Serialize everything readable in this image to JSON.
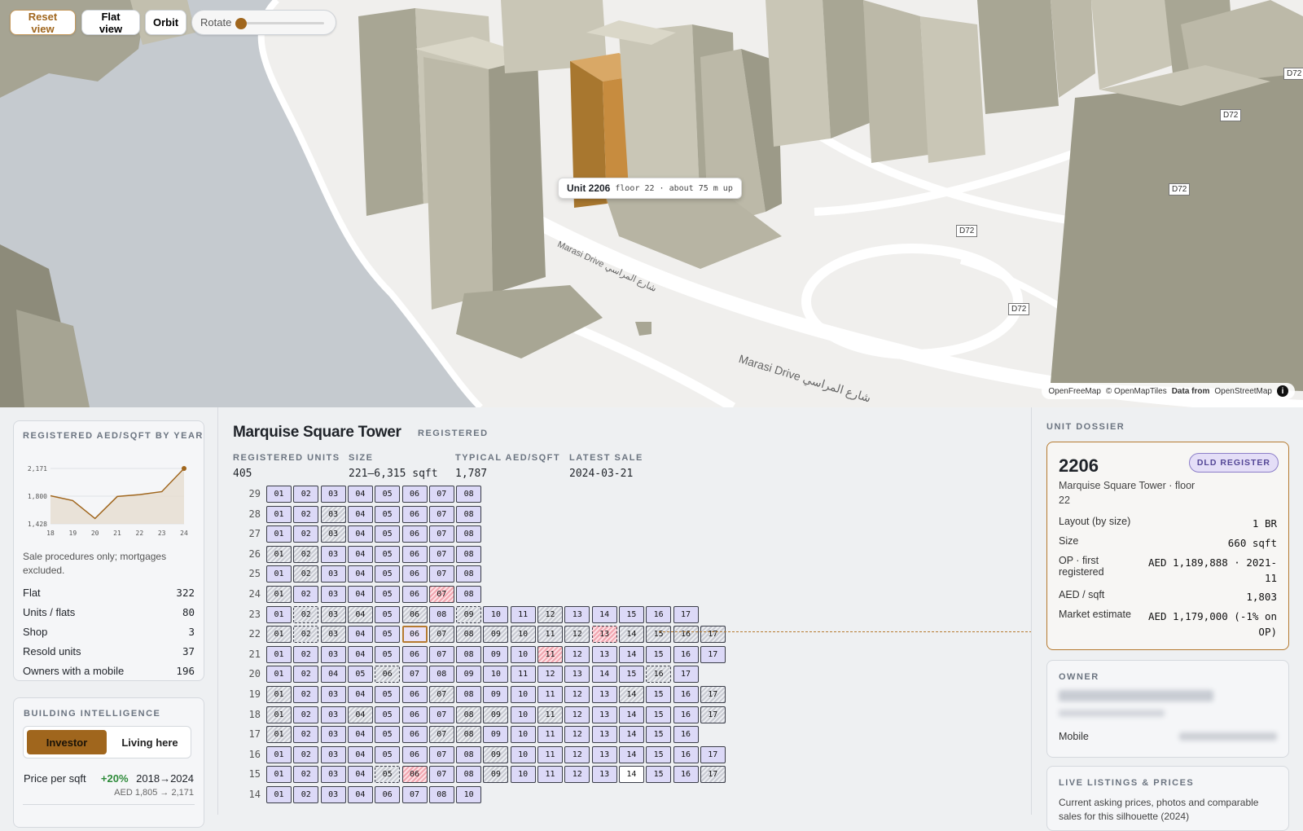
{
  "map": {
    "controls": {
      "reset": "Reset view",
      "flat": "Flat view",
      "orbit": "Orbit",
      "rotate": "Rotate"
    },
    "tooltip": {
      "unit": "Unit 2206",
      "detail": "floor 22 · about 75 m up"
    },
    "road_labels": [
      "D72",
      "D72",
      "D72",
      "D72",
      "D72"
    ],
    "street_labels": [
      "Marasi Drive شارع المراسي",
      "Marasi Drive شارع المراسي"
    ],
    "attribution": {
      "a": "OpenFreeMap",
      "b": "© OpenMapTiles",
      "c": "Data from",
      "d": "OpenStreetMap",
      "info": "i"
    },
    "colors": {
      "water": "#c5cacf",
      "land": "#f0efed",
      "building_light": "#c9c6b6",
      "building_dark": "#9c9a88",
      "highlight": "#b57a30"
    }
  },
  "left": {
    "chart_card": {
      "kicker": "REGISTERED AED/SQFT BY YEAR",
      "note": "Sale procedures only; mortgages excluded.",
      "rows": [
        {
          "label": "Flat",
          "value": "322"
        },
        {
          "label": "Units / flats",
          "value": "80"
        },
        {
          "label": "Shop",
          "value": "3"
        },
        {
          "label": "Resold units",
          "value": "37"
        },
        {
          "label": "Owners with a mobile",
          "value": "196"
        }
      ]
    },
    "intel_card": {
      "kicker": "BUILDING INTELLIGENCE",
      "tabs": [
        "Investor",
        "Living here"
      ],
      "price_label": "Price per sqft",
      "price_change": "+20%",
      "price_years": "2018→2024",
      "price_range": "AED 1,805 → 2,171"
    }
  },
  "chart_data": {
    "type": "line",
    "title": "REGISTERED AED/SQFT BY YEAR",
    "x": [
      "18",
      "19",
      "20",
      "21",
      "22",
      "23",
      "24"
    ],
    "values": [
      1805,
      1740,
      1500,
      1795,
      1820,
      1860,
      2171
    ],
    "yticks": [
      "2,171",
      "1,800",
      "1,428"
    ],
    "ylim": [
      1428,
      2171
    ],
    "color": "#a0661d"
  },
  "center": {
    "title": "Marquise Square Tower",
    "status": "REGISTERED",
    "stats": [
      {
        "label": "REGISTERED UNITS",
        "value": "405"
      },
      {
        "label": "SIZE",
        "value": "221–6,315 sqft"
      },
      {
        "label": "TYPICAL AED/SQFT",
        "value": "1,787"
      },
      {
        "label": "LATEST SALE",
        "value": "2024-03-21"
      }
    ],
    "floors": [
      {
        "floor": "29",
        "units": [
          "01",
          "02",
          "03",
          "04",
          "05",
          "06",
          "07",
          "08"
        ],
        "hatched": [],
        "pink": [],
        "dashed": []
      },
      {
        "floor": "28",
        "units": [
          "01",
          "02",
          "03",
          "04",
          "05",
          "06",
          "07",
          "08"
        ],
        "hatched": [
          "03"
        ],
        "pink": [],
        "dashed": []
      },
      {
        "floor": "27",
        "units": [
          "01",
          "02",
          "03",
          "04",
          "05",
          "06",
          "07",
          "08"
        ],
        "hatched": [
          "03"
        ],
        "pink": [],
        "dashed": []
      },
      {
        "floor": "26",
        "units": [
          "01",
          "02",
          "03",
          "04",
          "05",
          "06",
          "07",
          "08"
        ],
        "hatched": [
          "01",
          "02"
        ],
        "pink": [],
        "dashed": []
      },
      {
        "floor": "25",
        "units": [
          "01",
          "02",
          "03",
          "04",
          "05",
          "06",
          "07",
          "08"
        ],
        "hatched": [
          "02"
        ],
        "pink": [],
        "dashed": []
      },
      {
        "floor": "24",
        "units": [
          "01",
          "02",
          "03",
          "04",
          "05",
          "06",
          "07",
          "08"
        ],
        "hatched": [
          "01"
        ],
        "pink": [
          "07"
        ],
        "dashed": []
      },
      {
        "floor": "23",
        "units": [
          "01",
          "02",
          "03",
          "04",
          "05",
          "06",
          "08",
          "09",
          "10",
          "11",
          "12",
          "13",
          "14",
          "15",
          "16",
          "17"
        ],
        "hatched": [
          "02",
          "03",
          "04",
          "06",
          "09",
          "12"
        ],
        "pink": [],
        "dashed": [
          "02",
          "09"
        ]
      },
      {
        "floor": "22",
        "units": [
          "01",
          "02",
          "03",
          "04",
          "05",
          "06",
          "07",
          "08",
          "09",
          "10",
          "11",
          "12",
          "13",
          "14",
          "15",
          "16",
          "17"
        ],
        "hatched": [
          "01",
          "02",
          "03",
          "07",
          "08",
          "09",
          "10",
          "11",
          "12",
          "14",
          "15",
          "16",
          "17"
        ],
        "pink": [
          "13"
        ],
        "dashed": [
          "02",
          "13"
        ],
        "selected": "06"
      },
      {
        "floor": "21",
        "units": [
          "01",
          "02",
          "03",
          "04",
          "05",
          "06",
          "07",
          "08",
          "09",
          "10",
          "11",
          "12",
          "13",
          "14",
          "15",
          "16",
          "17"
        ],
        "hatched": [],
        "pink": [
          "11"
        ],
        "dashed": []
      },
      {
        "floor": "20",
        "units": [
          "01",
          "02",
          "04",
          "05",
          "06",
          "07",
          "08",
          "09",
          "10",
          "11",
          "12",
          "13",
          "14",
          "15",
          "16",
          "17"
        ],
        "hatched": [
          "06",
          "16"
        ],
        "pink": [],
        "dashed": [
          "06",
          "16"
        ]
      },
      {
        "floor": "19",
        "units": [
          "01",
          "02",
          "03",
          "04",
          "05",
          "06",
          "07",
          "08",
          "09",
          "10",
          "11",
          "12",
          "13",
          "14",
          "15",
          "16",
          "17"
        ],
        "hatched": [
          "01",
          "07",
          "14",
          "17"
        ],
        "pink": [],
        "dashed": []
      },
      {
        "floor": "18",
        "units": [
          "01",
          "02",
          "03",
          "04",
          "05",
          "06",
          "07",
          "08",
          "09",
          "10",
          "11",
          "12",
          "13",
          "14",
          "15",
          "16",
          "17"
        ],
        "hatched": [
          "01",
          "04",
          "08",
          "09",
          "11",
          "17"
        ],
        "pink": [],
        "dashed": []
      },
      {
        "floor": "17",
        "units": [
          "01",
          "02",
          "03",
          "04",
          "05",
          "06",
          "07",
          "08",
          "09",
          "10",
          "11",
          "12",
          "13",
          "14",
          "15",
          "16"
        ],
        "hatched": [
          "01",
          "07",
          "08"
        ],
        "pink": [],
        "dashed": []
      },
      {
        "floor": "16",
        "units": [
          "01",
          "02",
          "03",
          "04",
          "05",
          "06",
          "07",
          "08",
          "09",
          "10",
          "11",
          "12",
          "13",
          "14",
          "15",
          "16",
          "17"
        ],
        "hatched": [
          "09"
        ],
        "pink": [],
        "dashed": []
      },
      {
        "floor": "15",
        "units": [
          "01",
          "02",
          "03",
          "04",
          "05",
          "06",
          "07",
          "08",
          "09",
          "10",
          "11",
          "12",
          "13",
          "14",
          "15",
          "16",
          "17"
        ],
        "hatched": [
          "05",
          "09",
          "17"
        ],
        "pink": [
          "06"
        ],
        "dashed": [
          "05"
        ],
        "white": [
          "14"
        ]
      },
      {
        "floor": "14",
        "units": [
          "01",
          "02",
          "03",
          "04",
          "06",
          "07",
          "08",
          "10"
        ],
        "hatched": [],
        "pink": [],
        "dashed": []
      }
    ]
  },
  "right": {
    "kicker": "UNIT DOSSIER",
    "unit": "2206",
    "badge": "DLD REGISTER",
    "subtitle": "Marquise Square Tower · floor 22",
    "rows": [
      {
        "label": "Layout (by size)",
        "value": "1 BR"
      },
      {
        "label": "Size",
        "value": "660 sqft"
      },
      {
        "label": "OP · first registered",
        "value": "AED 1,189,888 · 2021-11"
      },
      {
        "label": "AED / sqft",
        "value": "1,803"
      },
      {
        "label": "Market estimate",
        "value": "AED 1,179,000 (-1% on OP)"
      }
    ],
    "owner_kicker": "OWNER",
    "mobile_label": "Mobile",
    "listings_kicker": "LIVE LISTINGS & PRICES",
    "listings_text": "Current asking prices, photos and comparable sales for this silhouette (2024)"
  }
}
